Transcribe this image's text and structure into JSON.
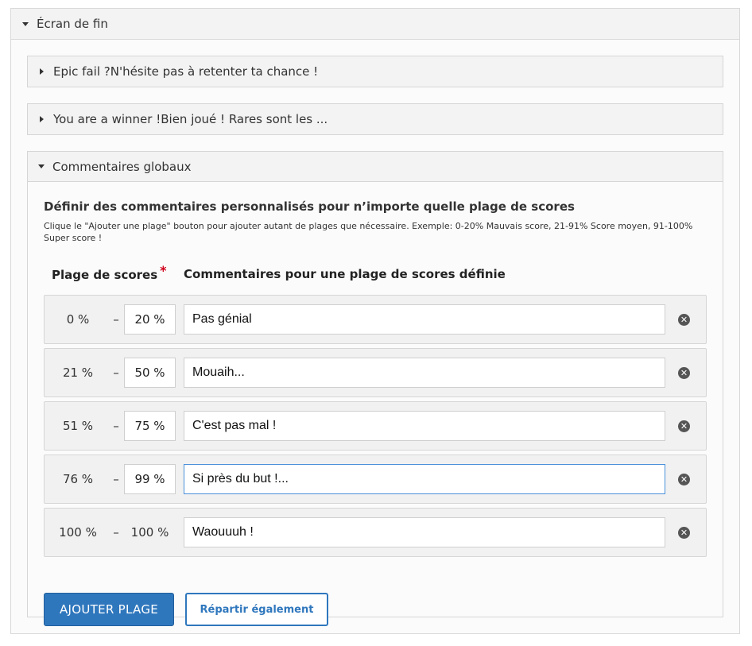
{
  "outer": {
    "title": "Écran de fin"
  },
  "panels": [
    {
      "title": "Epic fail ?N'hésite pas à retenter ta chance !"
    },
    {
      "title": "You are a winner !Bien joué ! Rares sont les ..."
    },
    {
      "title": "Commentaires globaux"
    }
  ],
  "global": {
    "heading": "Définir des commentaires personnalisés pour n’importe quelle plage de scores",
    "description": "Clique le \"Ajouter une plage\" bouton pour ajouter autant de plages que nécessaire. Exemple: 0-20% Mauvais score, 21-91% Score moyen, 91-100% Super score !",
    "col_range": "Plage de scores",
    "required_mark": "*",
    "col_comment": "Commentaires pour une plage de scores définie",
    "dash": "–",
    "ranges": [
      {
        "from": "0 %",
        "to": "20 %",
        "comment": "Pas génial"
      },
      {
        "from": "21 %",
        "to": "50 %",
        "comment": "Mouaih..."
      },
      {
        "from": "51 %",
        "to": "75 %",
        "comment": "C'est pas mal !"
      },
      {
        "from": "76 %",
        "to": "99 %",
        "comment": "Si près du but !..."
      },
      {
        "from": "100 %",
        "to": "100 %",
        "comment": "Waouuuh !"
      }
    ],
    "add_button": "AJOUTER PLAGE",
    "split_button": "Répartir également"
  },
  "icons": {
    "remove": "remove-circle-icon",
    "expand": "caret-down-icon",
    "collapse": "caret-right-icon"
  },
  "colors": {
    "primary": "#2f77bd",
    "required": "#d0021b",
    "focus": "#4a90d9"
  }
}
